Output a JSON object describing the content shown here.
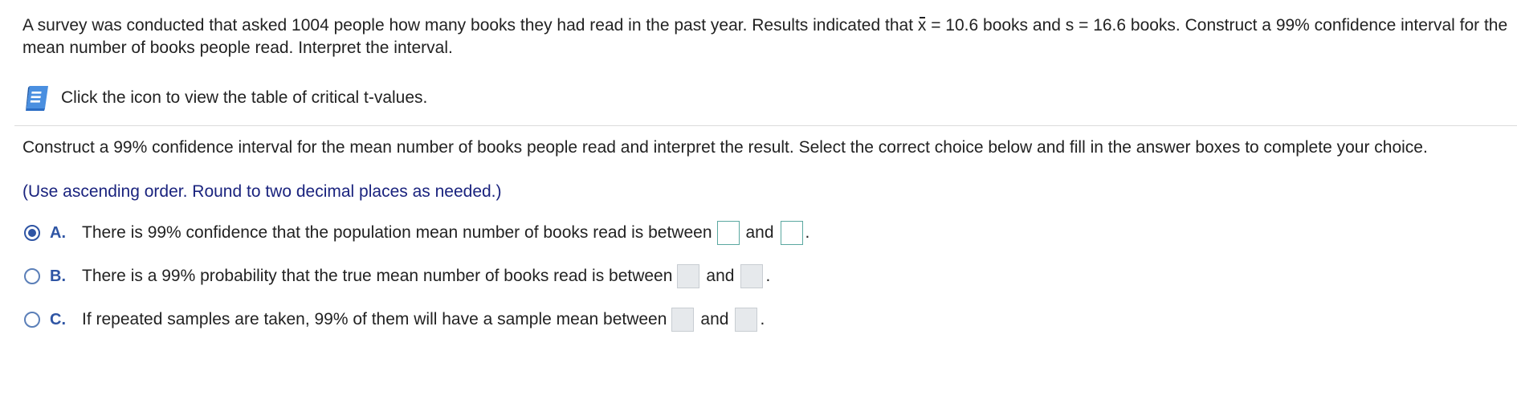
{
  "problem": {
    "text_1": "A survey was conducted that asked 1004 people how many books they had read in the past year. Results indicated that ",
    "xbar_symbol": "x",
    "text_2": " = 10.6 books and s = 16.6 books. Construct a 99% confidence interval for the mean number of books people read. Interpret the interval."
  },
  "hint": {
    "label": "Click the icon to view the table of critical t-values."
  },
  "question": {
    "text": "Construct a 99% confidence interval for the mean number of books people read and interpret the result. Select the correct choice below and fill in the answer boxes to complete your choice.",
    "instruction": "(Use ascending order. Round to two decimal places as needed.)"
  },
  "choices": [
    {
      "letter": "A.",
      "text": "There is 99% confidence that the population mean number of books read is between",
      "and": "and",
      "end": ".",
      "selected": true
    },
    {
      "letter": "B.",
      "text": "There is a 99% probability that the true mean number of books read is between",
      "and": "and",
      "end": ".",
      "selected": false
    },
    {
      "letter": "C.",
      "text": "If repeated samples are taken, 99% of them will have a sample mean between",
      "and": "and",
      "end": ".",
      "selected": false
    }
  ],
  "colors": {
    "accent_blue": "#2f55a4",
    "instruction_navy": "#1a237e",
    "active_box_border": "#5aa8a0",
    "disabled_box_fill": "#e6e9ec"
  },
  "icons": {
    "hint_icon": "book-icon"
  }
}
